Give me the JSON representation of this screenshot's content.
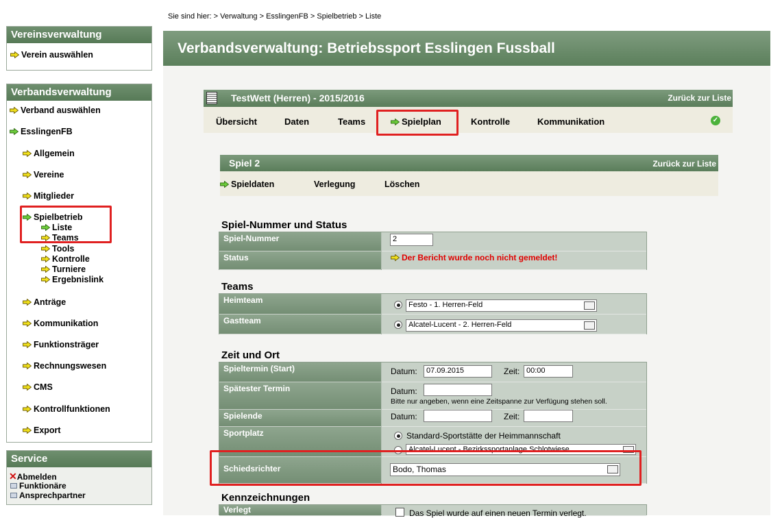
{
  "breadcrumb": "Sie sind hier: > Verwaltung > EsslingenFB > Spielbetrieb > Liste",
  "sidebar": {
    "vereinsverwaltung": {
      "title": "Vereinsverwaltung",
      "items": [
        "Verein auswählen"
      ]
    },
    "verbandsverwaltung": {
      "title": "Verbandsverwaltung",
      "items": [
        "Verband auswählen",
        "EsslingenFB",
        "Allgemein",
        "Vereine",
        "Mitglieder",
        "Spielbetrieb",
        "Anträge",
        "Kommunikation",
        "Funktionsträger",
        "Rechnungswesen",
        "CMS",
        "Kontrollfunktionen",
        "Export"
      ],
      "spielbetrieb_sub": [
        "Liste",
        "Teams",
        "Tools",
        "Kontrolle",
        "Turniere",
        "Ergebnislink"
      ]
    },
    "service": {
      "title": "Service",
      "items": [
        "Abmelden",
        "Funktionäre",
        "Ansprechpartner"
      ]
    }
  },
  "banner_title": "Verbandsverwaltung: Betriebssport Esslingen Fussball",
  "competition": {
    "title": "TestWett (Herren) - 2015/2016",
    "back": "Zurück zur Liste",
    "tabs": [
      "Übersicht",
      "Daten",
      "Teams",
      "Spielplan",
      "Kontrolle",
      "Kommunikation"
    ]
  },
  "spiel": {
    "title": "Spiel 2",
    "back": "Zurück zur Liste",
    "tabs": [
      "Spieldaten",
      "Verlegung",
      "Löschen"
    ]
  },
  "sections": {
    "nummer_status": "Spiel-Nummer und Status",
    "teams": "Teams",
    "zeit_ort": "Zeit und Ort",
    "kennzeichnungen": "Kennzeichnungen"
  },
  "fields": {
    "spiel_nummer": {
      "label": "Spiel-Nummer",
      "value": "2"
    },
    "status": {
      "label": "Status",
      "value": "Der Bericht wurde noch nicht gemeldet!"
    },
    "heimteam": {
      "label": "Heimteam",
      "value": "Festo - 1. Herren-Feld"
    },
    "gastteam": {
      "label": "Gastteam",
      "value": "Alcatel-Lucent - 2. Herren-Feld"
    },
    "spieltermin": {
      "label": "Spieltermin (Start)",
      "datum_label": "Datum:",
      "datum": "07.09.2015",
      "zeit_label": "Zeit:",
      "zeit": "00:00"
    },
    "spaetester": {
      "label": "Spätester Termin",
      "datum_label": "Datum:",
      "hint": "Bitte nur angeben, wenn eine Zeitspanne zur Verfügung stehen soll."
    },
    "spielende": {
      "label": "Spielende",
      "datum_label": "Datum:",
      "zeit_label": "Zeit:"
    },
    "sportplatz": {
      "label": "Sportplatz",
      "option1": "Standard-Sportstätte der Heimmannschaft",
      "option2": "Alcatel-Lucent - Bezirkssportanlage Schlotwiese"
    },
    "schiedsrichter": {
      "label": "Schiedsrichter",
      "value": "Bodo, Thomas"
    },
    "verlegt": {
      "label": "Verlegt",
      "text": "Das Spiel wurde auf einen neuen Termin verlegt."
    }
  },
  "colors": {
    "accent_green": "#5a7d5a",
    "highlight_red": "#e02020",
    "status_red": "#e00000"
  }
}
